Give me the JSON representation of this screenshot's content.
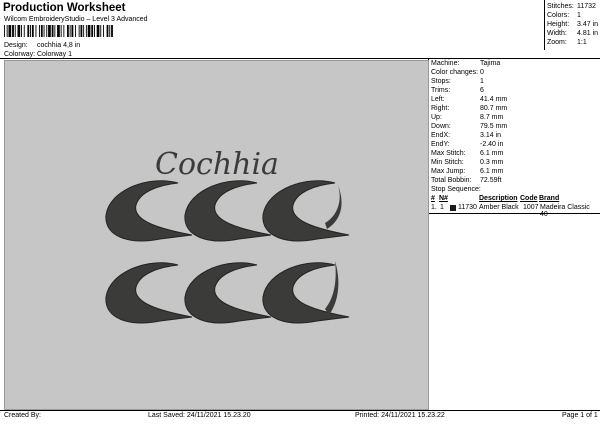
{
  "header": {
    "title": "Production Worksheet",
    "subtitle": "Wilcom EmbroideryStudio – Level 3 Advanced",
    "design_label": "Design:",
    "design_value": "cochhia 4,8 in",
    "colorway_label": "Colorway:",
    "colorway_value": "Colorway 1"
  },
  "summary": [
    {
      "label": "Stitches:",
      "value": "11732"
    },
    {
      "label": "Colors:",
      "value": "1"
    },
    {
      "label": "Height:",
      "value": "3.47 in"
    },
    {
      "label": "Width:",
      "value": "4.81 in"
    },
    {
      "label": "Zoom:",
      "value": "1:1"
    }
  ],
  "preview": {
    "design_text": "Cochhia",
    "thread_color": "#3b3b39",
    "background_color": "#c6c6c6"
  },
  "stats": [
    {
      "label": "Machine:",
      "value": "Tajima"
    },
    {
      "label": "Color changes:",
      "value": "0"
    },
    {
      "label": "Stops:",
      "value": "1"
    },
    {
      "label": "Trims:",
      "value": "6"
    },
    {
      "label": "Left:",
      "value": "41.4 mm"
    },
    {
      "label": "Right:",
      "value": "80.7 mm"
    },
    {
      "label": "Up:",
      "value": "8.7 mm"
    },
    {
      "label": "Down:",
      "value": "79.5 mm"
    },
    {
      "label": "EndX:",
      "value": "3.14 in"
    },
    {
      "label": "EndY:",
      "value": "-2.40 in"
    },
    {
      "label": "Max Stitch:",
      "value": "6.1 mm"
    },
    {
      "label": "Min Stitch:",
      "value": "0.3 mm"
    },
    {
      "label": "Max Jump:",
      "value": "6.1 mm"
    },
    {
      "label": "Total Bobbin:",
      "value": "72.59ft"
    }
  ],
  "stop_sequence": {
    "title": "Stop Sequence:",
    "columns": [
      "#",
      "N#",
      "Description",
      "Code",
      "Brand"
    ],
    "rows": [
      {
        "num": "1.",
        "n": "1",
        "swatch": "#1a1a1a",
        "stitches": "11730",
        "description": "Amber Black",
        "code": "1007",
        "brand": "Madeira Classic 40"
      }
    ]
  },
  "footer": {
    "created_by": "Created By:",
    "last_saved": "Last Saved: 24/11/2021 15.23.20",
    "printed": "Printed: 24/11/2021 15.23.22",
    "page": "Page 1 of 1"
  }
}
